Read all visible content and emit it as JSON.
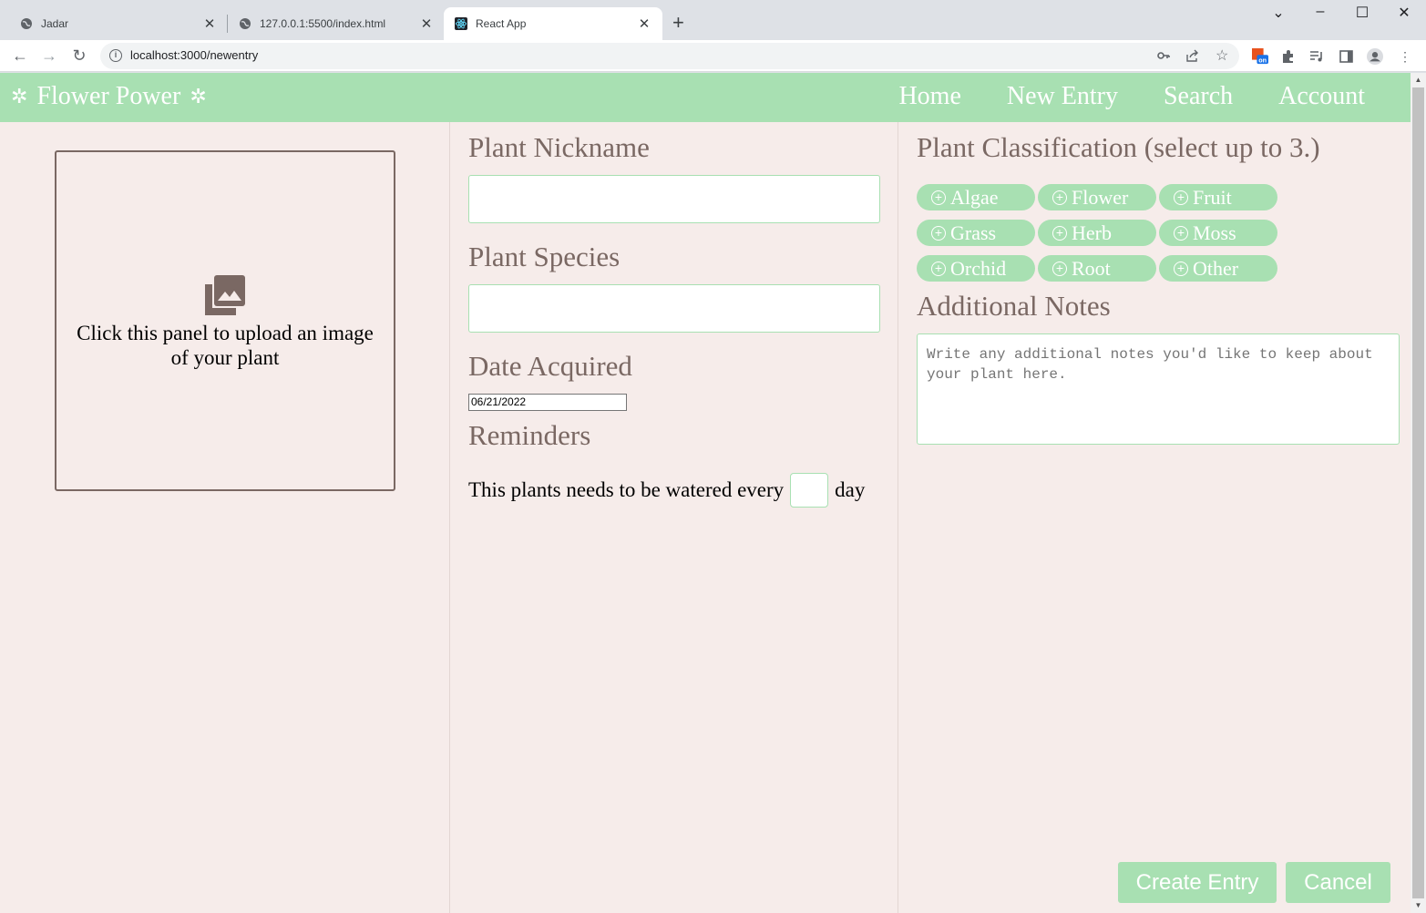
{
  "browser": {
    "tabs": [
      {
        "title": "Jadar",
        "favicon": "globe-icon"
      },
      {
        "title": "127.0.0.1:5500/index.html",
        "favicon": "globe-icon"
      },
      {
        "title": "React App",
        "favicon": "react-icon"
      }
    ],
    "url": "localhost:3000/newentry"
  },
  "app": {
    "brand": "Flower Power",
    "nav": [
      "Home",
      "New Entry",
      "Search",
      "Account"
    ],
    "upload_text": "Click this panel to upload an image of your plant",
    "nickname_label": "Plant Nickname",
    "nickname_value": "",
    "species_label": "Plant Species",
    "species_value": "",
    "date_label": "Date Acquired",
    "date_value": "06/21/2022",
    "reminders_label": "Reminders",
    "water_prefix": "This plants needs to be watered every",
    "water_value": "",
    "water_suffix": "day",
    "classification_label": "Plant Classification (select up to 3.)",
    "classifications": [
      "Algae",
      "Flower",
      "Fruit",
      "Grass",
      "Herb",
      "Moss",
      "Orchid",
      "Root",
      "Other"
    ],
    "notes_label": "Additional Notes",
    "notes_placeholder": "Write any additional notes you'd like to keep about your plant here.",
    "create_button": "Create Entry",
    "cancel_button": "Cancel"
  },
  "colors": {
    "accent": "#a8e0b2",
    "background": "#f6ecea",
    "label_text": "#7a6863"
  }
}
